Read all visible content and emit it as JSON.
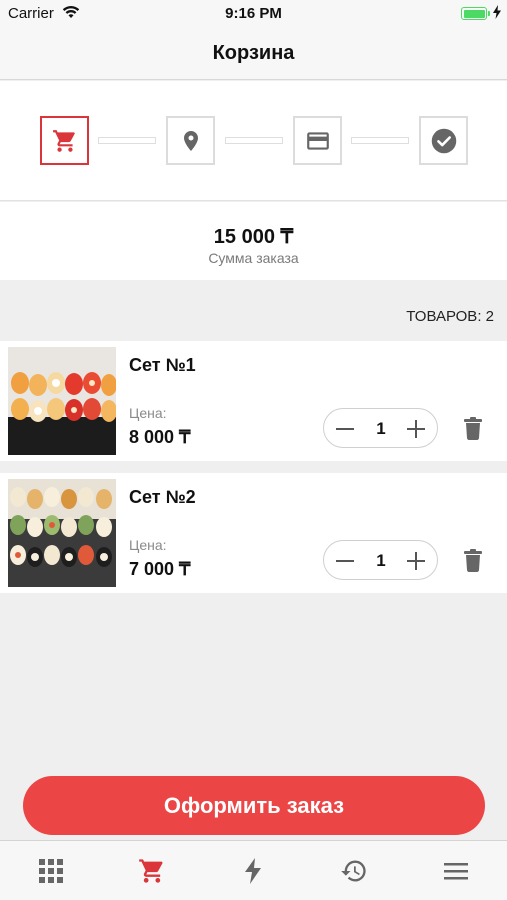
{
  "status_bar": {
    "carrier": "Carrier",
    "time": "9:16 PM"
  },
  "nav": {
    "title": "Корзина"
  },
  "steps": [
    {
      "icon": "cart-icon",
      "active": true
    },
    {
      "icon": "location-pin-icon",
      "active": false
    },
    {
      "icon": "credit-card-icon",
      "active": false
    },
    {
      "icon": "check-circle-icon",
      "active": false
    }
  ],
  "summary": {
    "amount": "15 000 ₸",
    "label": "Сумма заказа"
  },
  "cart": {
    "count_label": "ТОВАРОВ: 2",
    "items": [
      {
        "name": "Сет №1",
        "price_label": "Цена:",
        "price": "8 000 ₸",
        "quantity": "1"
      },
      {
        "name": "Сет №2",
        "price_label": "Цена:",
        "price": "7 000 ₸",
        "quantity": "1"
      }
    ]
  },
  "checkout": {
    "label": "Оформить заказ"
  },
  "tabs": [
    {
      "icon": "grid-icon",
      "active": false
    },
    {
      "icon": "cart-icon",
      "active": true
    },
    {
      "icon": "lightning-icon",
      "active": false
    },
    {
      "icon": "history-icon",
      "active": false
    },
    {
      "icon": "menu-icon",
      "active": false
    }
  ],
  "colors": {
    "accent": "#ec4545",
    "accent_dark": "#d9353a",
    "icon_gray": "#666666",
    "battery": "#4cd964"
  }
}
